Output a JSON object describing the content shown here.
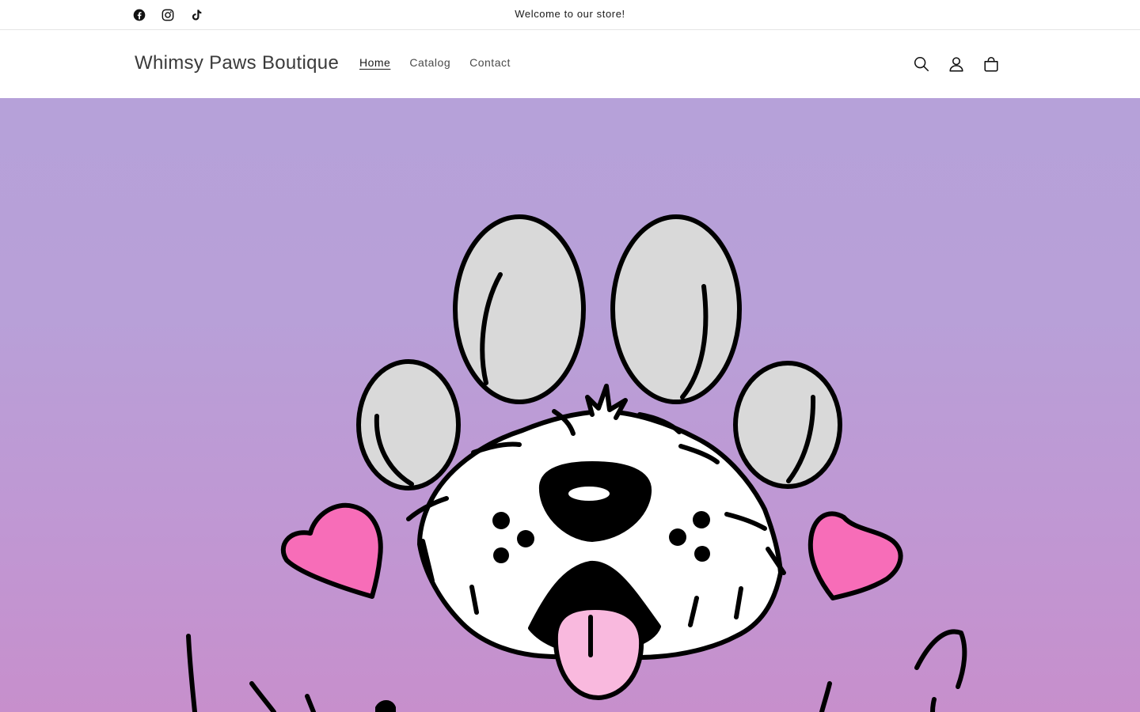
{
  "announcement": {
    "text": "Welcome to our store!",
    "socials": [
      {
        "icon": "facebook-icon"
      },
      {
        "icon": "instagram-icon"
      },
      {
        "icon": "tiktok-icon"
      }
    ]
  },
  "header": {
    "logo": "Whimsy Paws Boutique",
    "nav": [
      {
        "label": "Home",
        "active": true
      },
      {
        "label": "Catalog",
        "active": false
      },
      {
        "label": "Contact",
        "active": false
      }
    ],
    "icons": [
      "search-icon",
      "account-icon",
      "cart-icon"
    ]
  },
  "hero": {
    "background_top": "#b6a1d9",
    "background_bottom": "#c78fcc",
    "illustration": "dog-paw-logo",
    "colors": {
      "toe_fill": "#d9d9d9",
      "heart_fill": "#f76db8",
      "tongue_fill": "#f9b9de",
      "outline": "#000000"
    }
  }
}
